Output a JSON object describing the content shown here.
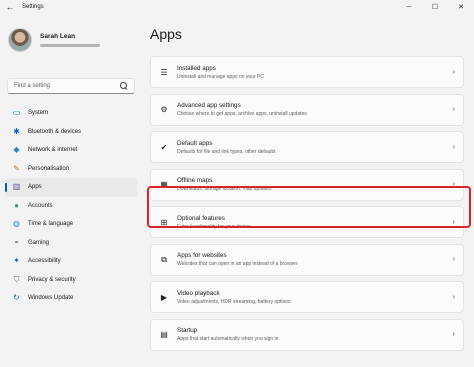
{
  "window": {
    "title": "Settings",
    "back_glyph": "←",
    "controls": [
      "─",
      "☐",
      "✕"
    ]
  },
  "profile": {
    "name": "Sarah Lean"
  },
  "search": {
    "placeholder": "Find a setting"
  },
  "sidebar": {
    "items": [
      {
        "label": "System",
        "icon": "system-icon",
        "glyph": "▭",
        "color": "#0078d4",
        "active": false
      },
      {
        "label": "Bluetooth & devices",
        "icon": "bluetooth-icon",
        "glyph": "✱",
        "color": "#0067c0",
        "active": false
      },
      {
        "label": "Network & internet",
        "icon": "wifi-icon",
        "glyph": "◆",
        "color": "#2a7fd4",
        "active": false
      },
      {
        "label": "Personalisation",
        "icon": "brush-icon",
        "glyph": "✎",
        "color": "#c8702a",
        "active": false
      },
      {
        "label": "Apps",
        "icon": "apps-icon",
        "glyph": "▥",
        "color": "#5d5a9e",
        "active": true
      },
      {
        "label": "Accounts",
        "icon": "person-icon",
        "glyph": "●",
        "color": "#3aa060",
        "active": false
      },
      {
        "label": "Time & language",
        "icon": "globe-icon",
        "glyph": "◍",
        "color": "#1c8fd0",
        "active": false
      },
      {
        "label": "Gaming",
        "icon": "gamepad-icon",
        "glyph": "◓",
        "color": "#767676",
        "active": false
      },
      {
        "label": "Accessibility",
        "icon": "accessibility-icon",
        "glyph": "✦",
        "color": "#1267c4",
        "active": false
      },
      {
        "label": "Privacy & security",
        "icon": "shield-icon",
        "glyph": "⛉",
        "color": "#6b6b6b",
        "active": false
      },
      {
        "label": "Windows Update",
        "icon": "update-icon",
        "glyph": "↻",
        "color": "#0a6ed1",
        "active": false
      }
    ]
  },
  "main": {
    "title": "Apps",
    "cards": [
      {
        "title": "Installed apps",
        "subtitle": "Uninstall and manage apps on your PC",
        "icon": "list-icon",
        "glyph": "☰"
      },
      {
        "title": "Advanced app settings",
        "subtitle": "Choose where to get apps, archive apps, uninstall updates",
        "icon": "app-settings-icon",
        "glyph": "⚙"
      },
      {
        "title": "Default apps",
        "subtitle": "Defaults for file and link types, other defaults",
        "icon": "default-apps-icon",
        "glyph": "✔"
      },
      {
        "title": "Offline maps",
        "subtitle": "Downloads, storage location, map updates",
        "icon": "map-icon",
        "glyph": "▦"
      },
      {
        "title": "Optional features",
        "subtitle": "Extra functionality for your device",
        "icon": "optional-features-icon",
        "glyph": "⊞"
      },
      {
        "title": "Apps for websites",
        "subtitle": "Websites that can open in an app instead of a browser",
        "icon": "web-apps-icon",
        "glyph": "⧉"
      },
      {
        "title": "Video playback",
        "subtitle": "Video adjustments, HDR streaming, battery options",
        "icon": "video-icon",
        "glyph": "▶"
      },
      {
        "title": "Startup",
        "subtitle": "Apps that start automatically when you sign in",
        "icon": "startup-icon",
        "glyph": "▤"
      }
    ],
    "chevron": "›"
  },
  "colors": {
    "accent": "#005fb8",
    "highlight_border": "#d9252a"
  }
}
